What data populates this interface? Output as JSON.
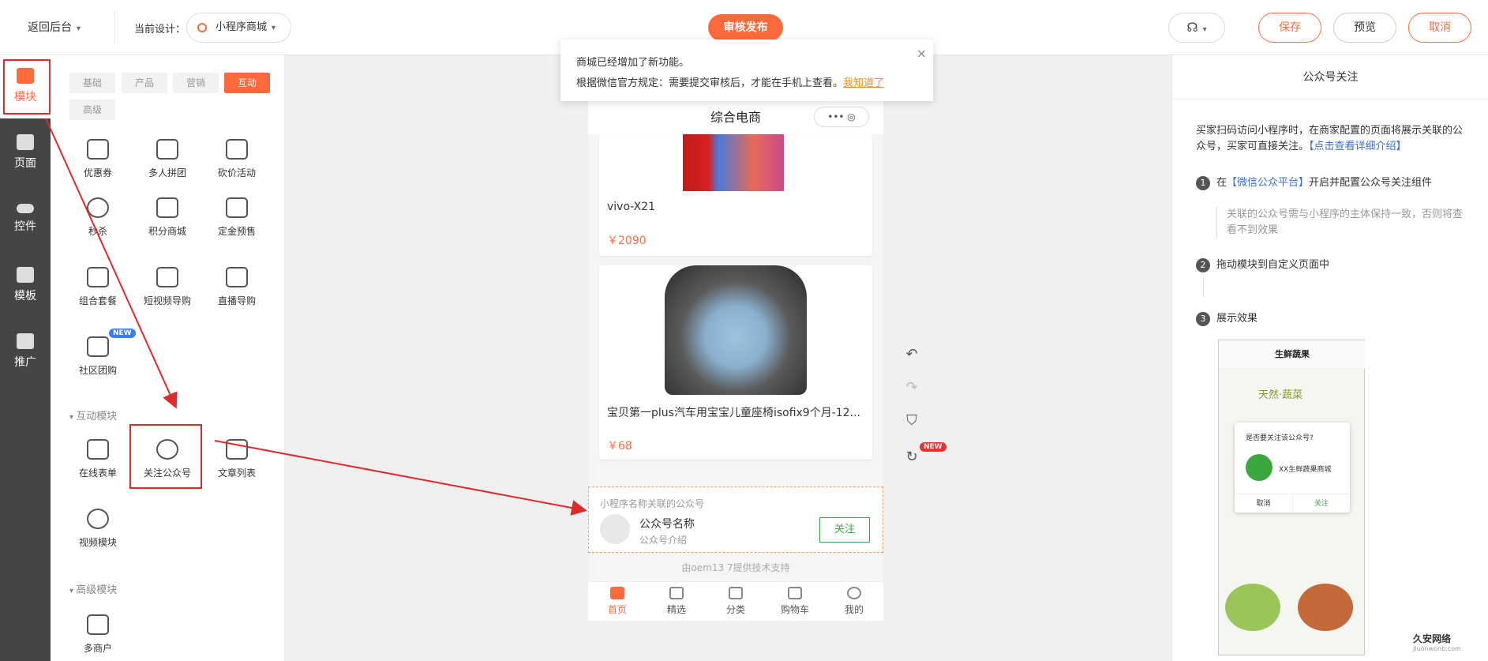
{
  "topbar": {
    "back_label": "返回后台",
    "current_design_label": "当前设计：",
    "design_name": "小程序商城",
    "publish_label": "审核发布",
    "save_label": "保存",
    "preview_label": "预览",
    "cancel_label": "取消"
  },
  "sidenav": [
    {
      "label": "模块",
      "icon": "module-icon",
      "active": true
    },
    {
      "label": "页面",
      "icon": "page-icon"
    },
    {
      "label": "控件",
      "icon": "toggle-icon"
    },
    {
      "label": "模板",
      "icon": "template-icon"
    },
    {
      "label": "推广",
      "icon": "megaphone-icon"
    }
  ],
  "tabs": [
    "基础",
    "产品",
    "营销",
    "互动",
    "高级"
  ],
  "modules": {
    "row1": [
      "优惠券",
      "多人拼团",
      "砍价活动"
    ],
    "row2": [
      "秒杀",
      "积分商城",
      "定金预售"
    ],
    "row3": [
      "组合套餐",
      "短视频导购",
      "直播导购"
    ],
    "row4": [
      "社区团购"
    ],
    "new_badge": "NEW",
    "section_interactive": "互动模块",
    "interactive": [
      "在线表单",
      "关注公众号",
      "文章列表"
    ],
    "video": "视频模块",
    "section_advanced": "高级模块",
    "advanced": [
      "多商户"
    ]
  },
  "notice": {
    "line1": "商城已经增加了新功能。",
    "line2": "根据微信官方规定：需要提交审核后，才能在手机上查看。",
    "link": "我知道了",
    "close": "×"
  },
  "phone": {
    "title": "综合电商",
    "capsule": "••• ◎",
    "product1": {
      "name": "vivo-X21",
      "price": "￥2090"
    },
    "product2": {
      "name": "宝贝第一plus汽车用宝宝儿童座椅isofix9个月-12...",
      "price": "￥68"
    },
    "follow": {
      "title": "小程序名称关联的公众号",
      "name": "公众号名称",
      "desc": "公众号介绍",
      "button": "关注"
    },
    "powered": "由oem13          7提供技术支持",
    "tabbar": [
      "首页",
      "精选",
      "分类",
      "购物车",
      "我的"
    ]
  },
  "tools": {
    "new_badge": "NEW"
  },
  "right": {
    "title": "公众号关注",
    "desc": "买家扫码访问小程序时，在商家配置的页面将展示关联的公众号，买家可直接关注。",
    "desc_link": "【点击查看详细介绍】",
    "step1_pre": "在",
    "step1_link": "【微信公众平台】",
    "step1_post": "开启并配置公众号关注组件",
    "step1_note": "关联的公众号需与小程序的主体保持一致，否则将查看不到效果",
    "step2": "拖动模块到自定义页面中",
    "step3": "展示效果",
    "mock": {
      "title": "生鲜蔬果",
      "leaf": "天然·蔬菜",
      "question": "是否要关注该公众号?",
      "name": "XX生鲜蔬果商城",
      "cancel": "取消",
      "follow": "关注"
    }
  },
  "watermark": {
    "name": "久安网络",
    "url": "Jiuonwonb.com"
  },
  "colors": {
    "accent": "#ff6a3c",
    "green": "#3aa83f",
    "annotation": "#e02a2a"
  }
}
